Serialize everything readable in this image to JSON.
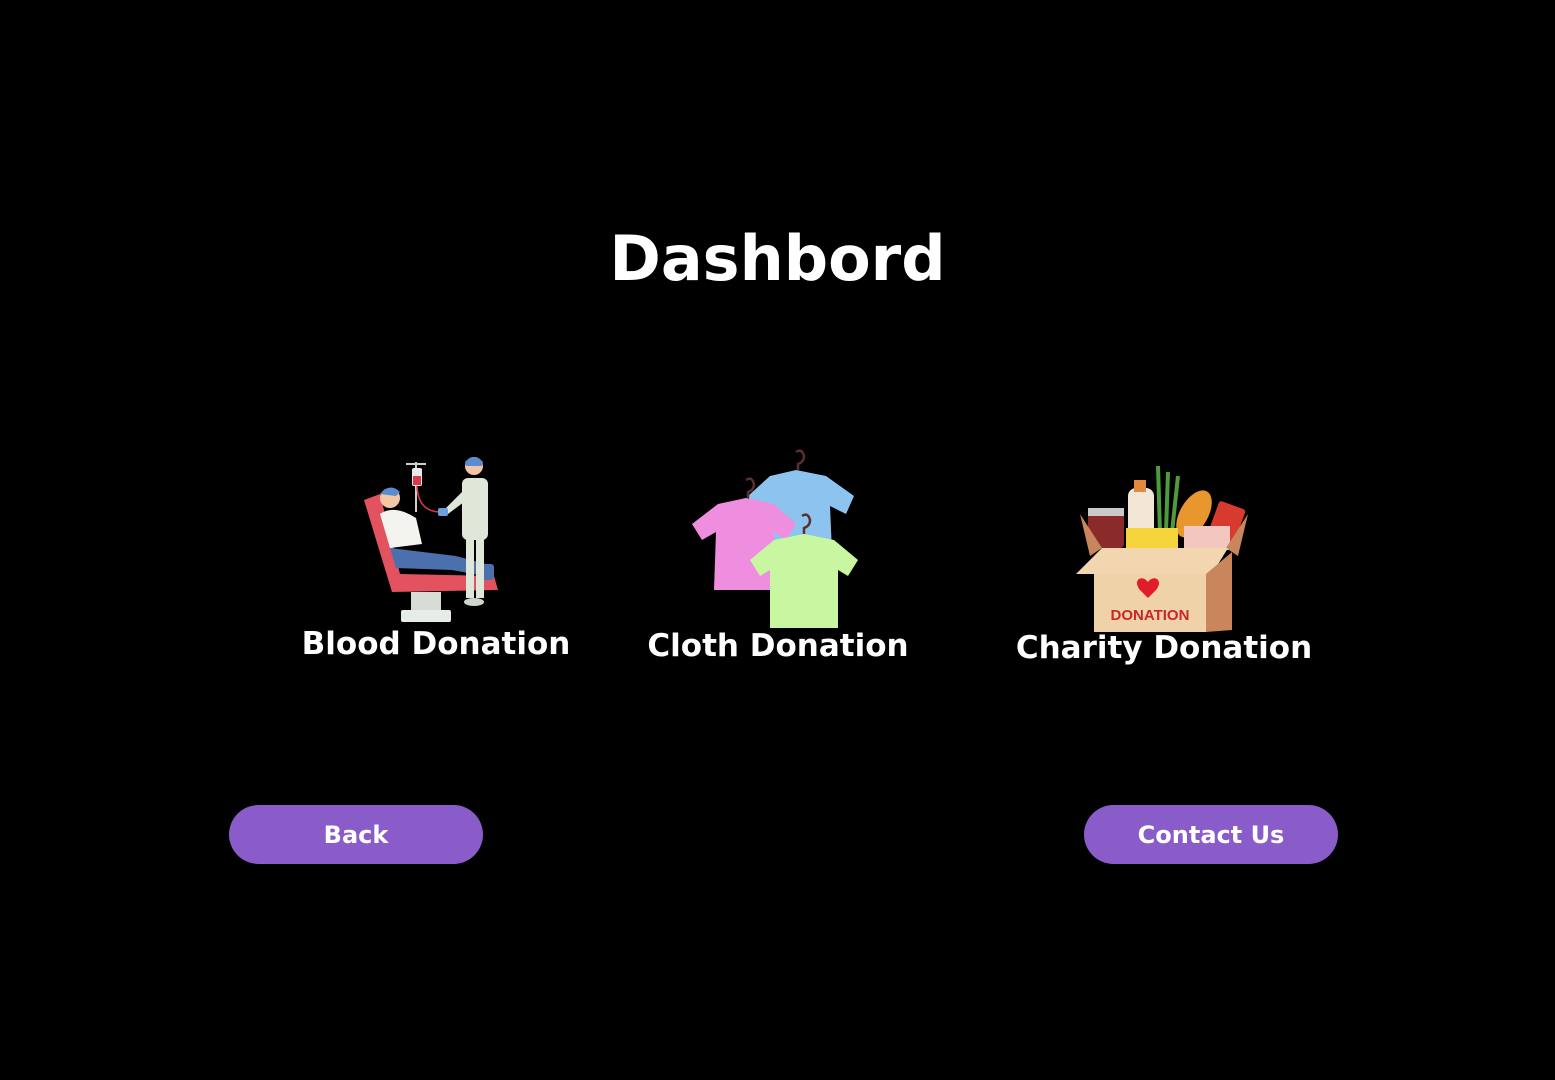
{
  "page": {
    "title": "Dashbord"
  },
  "cards": [
    {
      "label": "Blood Donation",
      "icon": "blood-donation-icon"
    },
    {
      "label": "Cloth Donation",
      "icon": "cloth-donation-icon"
    },
    {
      "label": "Charity Donation",
      "icon": "charity-donation-icon",
      "box_text": "DONATION"
    }
  ],
  "buttons": {
    "back": "Back",
    "contact": "Contact Us"
  },
  "colors": {
    "background": "#000000",
    "button": "#8a5cc9",
    "text": "#ffffff"
  }
}
